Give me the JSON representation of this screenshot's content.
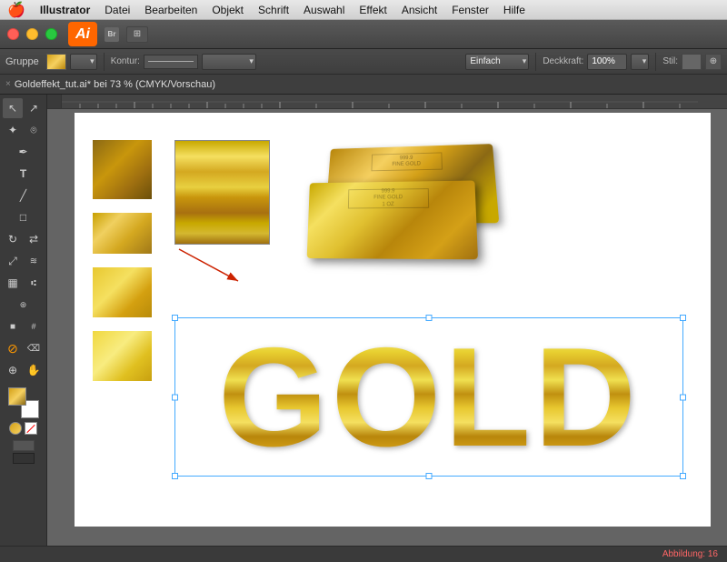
{
  "menubar": {
    "apple": "🍎",
    "items": [
      "Illustrator",
      "Datei",
      "Bearbeiten",
      "Objekt",
      "Schrift",
      "Auswahl",
      "Effekt",
      "Ansicht",
      "Fenster",
      "Hilfe"
    ]
  },
  "titlebar": {
    "ai_logo": "Ai",
    "br_badge": "Br",
    "layout_icon": "⊞"
  },
  "optionsbar": {
    "group_label": "Gruppe",
    "kontur_label": "Kontur:",
    "stroke_style": "Einfach",
    "deckkraft_label": "Deckkraft:",
    "deckkraft_value": "100%",
    "stil_label": "Stil:"
  },
  "doctab": {
    "close": "×",
    "title": "Goldeffekt_tut.ai* bei 73 % (CMYK/Vorschau)"
  },
  "canvas": {
    "gold_text": "GOLD"
  },
  "statusbar": {
    "text": "Abbildung: 16"
  },
  "toolbar": {
    "tools": [
      {
        "name": "selection-tool",
        "icon": "↖",
        "active": true
      },
      {
        "name": "direct-selection-tool",
        "icon": "↗"
      },
      {
        "name": "magic-wand-tool",
        "icon": "✦"
      },
      {
        "name": "lasso-tool",
        "icon": "⌾"
      },
      {
        "name": "pen-tool",
        "icon": "✒"
      },
      {
        "name": "text-tool",
        "icon": "T"
      },
      {
        "name": "line-tool",
        "icon": "╱"
      },
      {
        "name": "rectangle-tool",
        "icon": "□"
      },
      {
        "name": "rotate-tool",
        "icon": "↻"
      },
      {
        "name": "reflect-tool",
        "icon": "⇄"
      },
      {
        "name": "scale-tool",
        "icon": "⤢"
      },
      {
        "name": "warp-tool",
        "icon": "≋"
      },
      {
        "name": "graph-tool",
        "icon": "▦"
      },
      {
        "name": "gradient-tool",
        "icon": "■"
      },
      {
        "name": "eyedropper-tool",
        "icon": "⊘"
      },
      {
        "name": "zoom-tool",
        "icon": "⊕"
      }
    ]
  }
}
